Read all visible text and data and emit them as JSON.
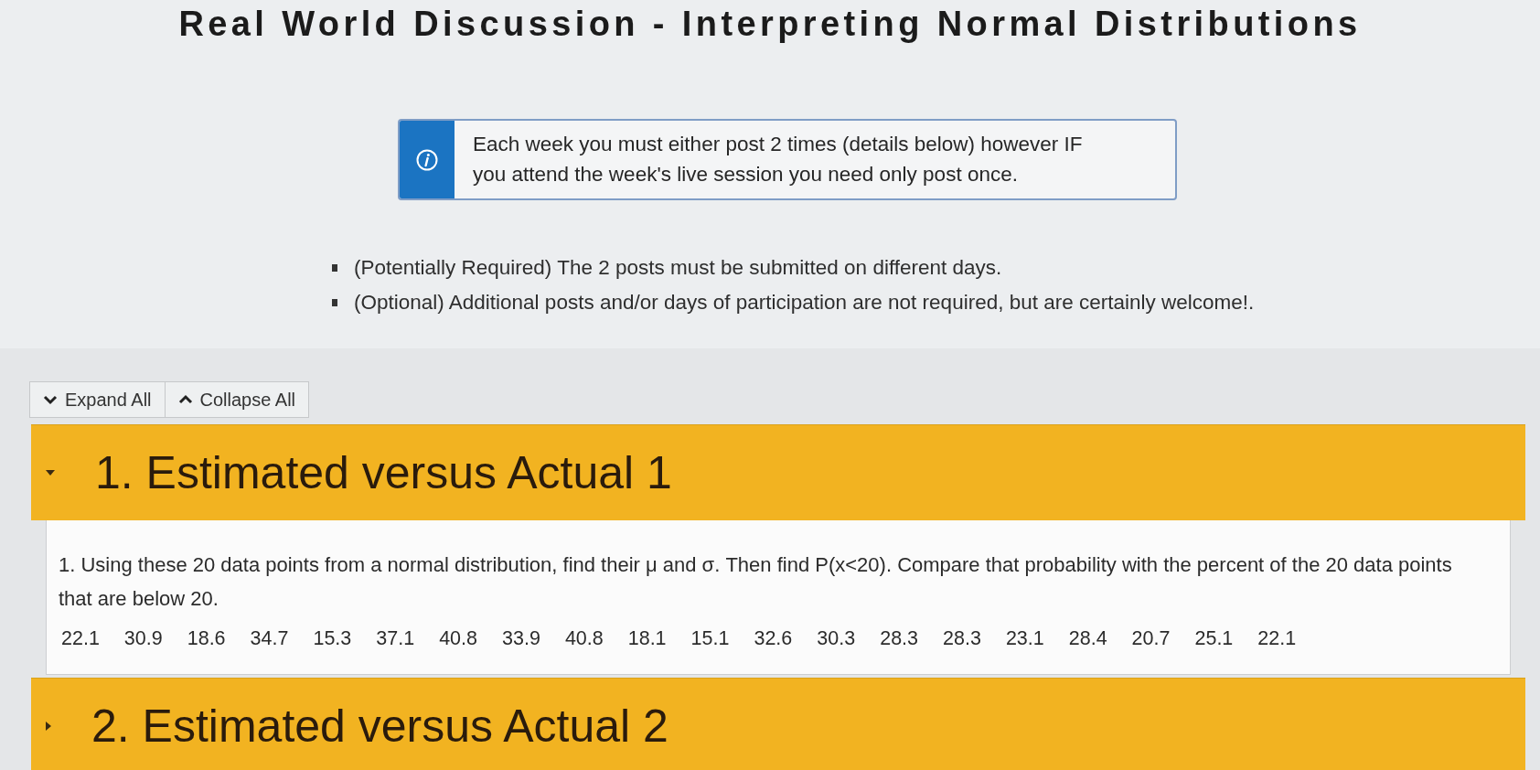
{
  "title": "Real World Discussion - Interpreting Normal Distributions",
  "notice": {
    "text": "Each week you must either post 2 times (details below) however IF you attend the week's live session you need only post once."
  },
  "requirements": [
    "(Potentially Required) The 2 posts must be submitted on different days.",
    "(Optional) Additional posts and/or days of participation are not required, but are certainly welcome!."
  ],
  "toolbar": {
    "buttons": [
      {
        "label": "Expand All",
        "kind": "expand"
      },
      {
        "label": "Collapse All",
        "kind": "collapse"
      }
    ]
  },
  "sections": [
    {
      "title": "1. Estimated versus Actual 1",
      "expanded": true,
      "body": {
        "text": "1. Using these 20 data points from a normal distribution, find their μ and σ. Then find P(x<20). Compare that probability with the percent of the 20 data points that are below 20.",
        "data_points": [
          "22.1",
          "30.9",
          "18.6",
          "34.7",
          "15.3",
          "37.1",
          "40.8",
          "33.9",
          "40.8",
          "18.1",
          "15.1",
          "32.6",
          "30.3",
          "28.3",
          "28.3",
          "23.1",
          "28.4",
          "20.7",
          "25.1",
          "22.1"
        ]
      }
    },
    {
      "title": "2. Estimated versus Actual 2",
      "expanded": false
    }
  ]
}
